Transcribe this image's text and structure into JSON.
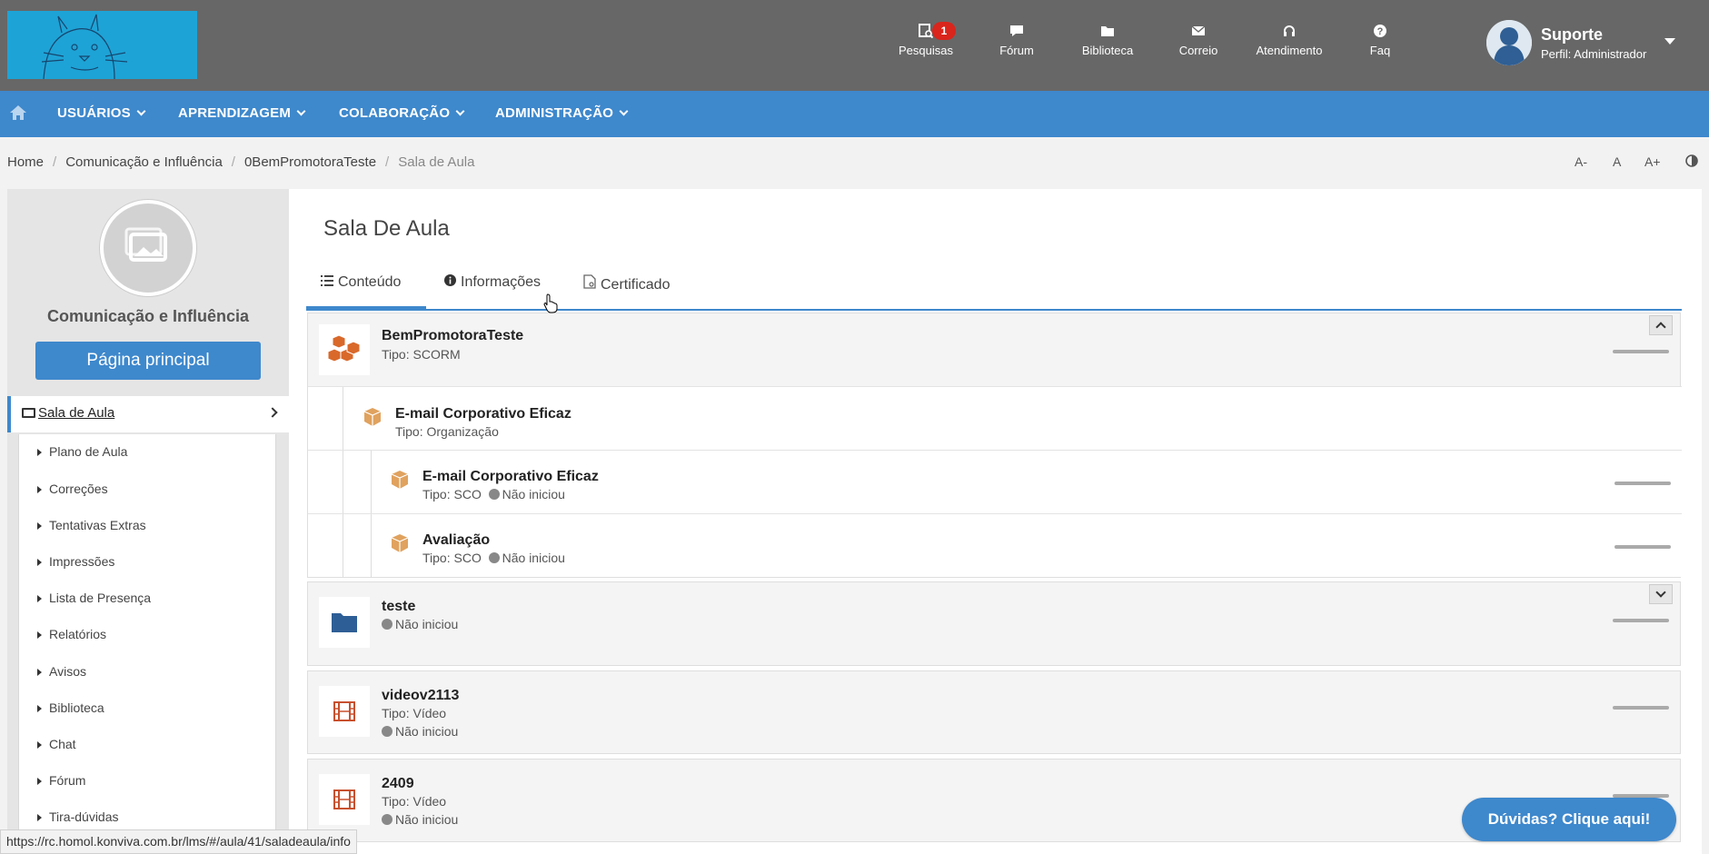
{
  "header": {
    "icons": [
      {
        "label": "Pesquisas",
        "icon": "survey-icon",
        "badge": "1"
      },
      {
        "label": "Fórum",
        "icon": "chat-bubble-icon"
      },
      {
        "label": "Biblioteca",
        "icon": "folder-icon"
      },
      {
        "label": "Correio",
        "icon": "envelope-icon"
      },
      {
        "label": "Atendimento",
        "icon": "headset-icon"
      },
      {
        "label": "Faq",
        "icon": "question-icon"
      }
    ],
    "user": {
      "name": "Suporte",
      "role": "Perfil: Administrador"
    }
  },
  "nav": {
    "items": [
      "USUÁRIOS",
      "APRENDIZAGEM",
      "COLABORAÇÃO",
      "ADMINISTRAÇÃO"
    ]
  },
  "breadcrumb": [
    "Home",
    "Comunicação e Influência",
    "0BemPromotoraTeste",
    "Sala de Aula"
  ],
  "font_controls": [
    "A-",
    "A",
    "A+"
  ],
  "sidebar": {
    "course_title": "Comunicação e Influência",
    "main_button": "Página principal",
    "active_item": "Sala de Aula",
    "items": [
      "Plano de Aula",
      "Correções",
      "Tentativas Extras",
      "Impressões",
      "Lista de Presença",
      "Relatórios",
      "Avisos",
      "Biblioteca",
      "Chat",
      "Fórum",
      "Tira-dúvidas"
    ]
  },
  "main": {
    "title": "Sala De Aula",
    "tabs": [
      "Conteúdo",
      "Informações",
      "Certificado"
    ],
    "modules": {
      "m1": {
        "title": "BemPromotoraTeste",
        "sub": "Tipo: SCORM"
      },
      "org": {
        "title": "E-mail Corporativo Eficaz",
        "sub": "Tipo: Organização"
      },
      "sco1": {
        "title": "E-mail Corporativo Eficaz",
        "type": "Tipo: SCO",
        "status": "Não iniciou"
      },
      "sco2": {
        "title": "Avaliação",
        "type": "Tipo: SCO",
        "status": "Não iniciou"
      },
      "m2": {
        "title": "teste",
        "status": "Não iniciou"
      },
      "m3": {
        "title": "videov2113",
        "sub": "Tipo: Vídeo",
        "status": "Não iniciou"
      },
      "m4": {
        "title": "2409",
        "sub": "Tipo: Vídeo",
        "status": "Não iniciou"
      }
    }
  },
  "statusbar": "https://rc.homol.konviva.com.br/lms/#/aula/41/saladeaula/info",
  "help_button": "Dúvidas? Clique aqui!",
  "colors": {
    "header": "#676767",
    "accent": "#3e88cc",
    "badge": "#d9251c",
    "scorm_orange": "#d9692b",
    "folder_blue": "#2e5e96",
    "video_red": "#c8502e"
  }
}
